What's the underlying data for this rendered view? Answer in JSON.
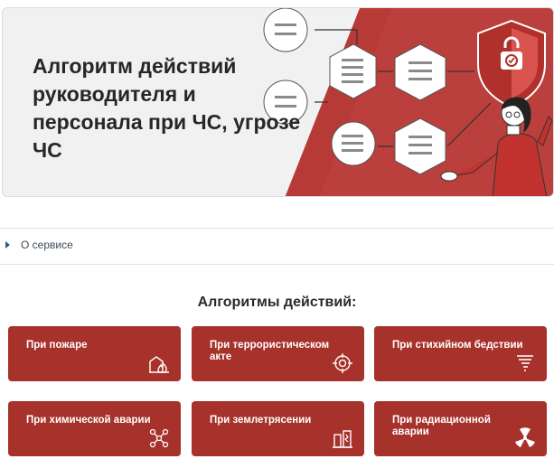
{
  "banner": {
    "title": "Алгоритм действий руководителя и персонала при ЧС, угрозе ЧС"
  },
  "about": {
    "label": "О сервисе"
  },
  "section": {
    "title": "Алгоритмы действий:"
  },
  "cards": [
    {
      "label": "При пожаре",
      "icon": "fire-building-icon"
    },
    {
      "label": "При террористическом акте",
      "icon": "target-crosshair-icon"
    },
    {
      "label": "При стихийном бедствии",
      "icon": "tornado-icon"
    },
    {
      "label": "При химической аварии",
      "icon": "molecule-icon"
    },
    {
      "label": "При землетрясении",
      "icon": "cracked-buildings-icon"
    },
    {
      "label": "При радиационной аварии",
      "icon": "radiation-icon"
    }
  ],
  "colors": {
    "accent": "#a7312b",
    "banner_bg": "#f1f1f1",
    "link_arrow": "#2d5a8c"
  }
}
